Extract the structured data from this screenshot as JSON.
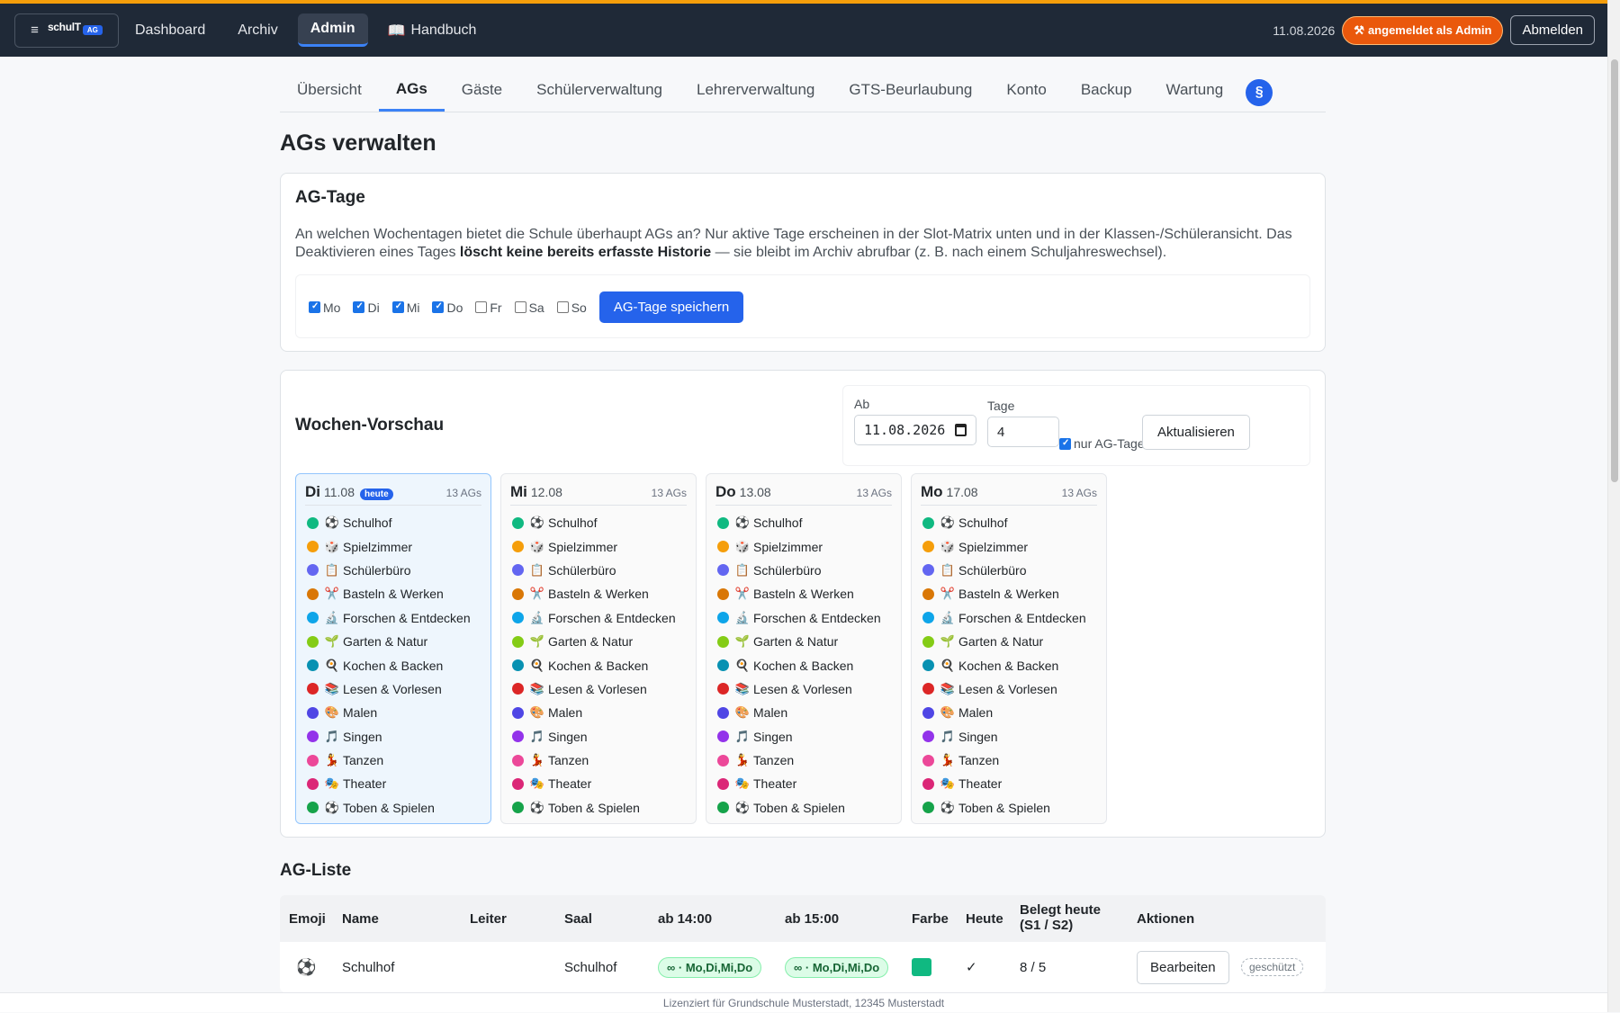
{
  "navbar": {
    "brand_logo": "schulT",
    "brand_tag": "AG",
    "links": [
      {
        "label": "Dashboard"
      },
      {
        "label": "Archiv"
      },
      {
        "label": "Admin"
      },
      {
        "label": "Handbuch",
        "icon": "📖"
      }
    ],
    "date": "11.08.2026",
    "admin_badge": "angemeldet als Admin",
    "logout": "Abmelden"
  },
  "tabs": [
    "Übersicht",
    "AGs",
    "Gäste",
    "Schülerverwaltung",
    "Lehrerverwaltung",
    "GTS-Beurlaubung",
    "Konto",
    "Backup",
    "Wartung"
  ],
  "tab_icon": "§",
  "page_title": "AGs verwalten",
  "ag_days": {
    "title": "AG-Tage",
    "desc_1": "An welchen Wochentagen bietet die Schule überhaupt AGs an? Nur aktive Tage erscheinen in der Slot-Matrix unten und in der Klassen-/Schüleransicht. Das Deaktivieren eines Tages ",
    "desc_bold": "löscht keine bereits erfasste Historie",
    "desc_2": " — sie bleibt im Archiv abrufbar (z. B. nach einem Schuljahreswechsel).",
    "days": [
      {
        "label": "Mo",
        "checked": true
      },
      {
        "label": "Di",
        "checked": true
      },
      {
        "label": "Mi",
        "checked": true
      },
      {
        "label": "Do",
        "checked": true
      },
      {
        "label": "Fr",
        "checked": false
      },
      {
        "label": "Sa",
        "checked": false
      },
      {
        "label": "So",
        "checked": false
      }
    ],
    "save": "AG-Tage speichern"
  },
  "week": {
    "title": "Wochen-Vorschau",
    "from_label": "Ab",
    "from_value": "11.08.2026",
    "days_label": "Tage",
    "days_value": "4",
    "only_ag_days": "nur AG-Tage",
    "refresh": "Aktualisieren",
    "columns": [
      {
        "day": "Di",
        "date": "11.08",
        "badge": "heute",
        "count": "13 AGs"
      },
      {
        "day": "Mi",
        "date": "12.08",
        "count": "13 AGs"
      },
      {
        "day": "Do",
        "date": "13.08",
        "count": "13 AGs"
      },
      {
        "day": "Mo",
        "date": "17.08",
        "count": "13 AGs"
      }
    ],
    "items": [
      {
        "emoji": "⚽",
        "name": "Schulhof",
        "color": "#10b981"
      },
      {
        "emoji": "🎲",
        "name": "Spielzimmer",
        "color": "#f59e0b"
      },
      {
        "emoji": "📋",
        "name": "Schülerbüro",
        "color": "#6366f1"
      },
      {
        "emoji": "✂️",
        "name": "Basteln & Werken",
        "color": "#d97706"
      },
      {
        "emoji": "🔬",
        "name": "Forschen & Entdecken",
        "color": "#0ea5e9"
      },
      {
        "emoji": "🌱",
        "name": "Garten & Natur",
        "color": "#84cc16"
      },
      {
        "emoji": "🍳",
        "name": "Kochen & Backen",
        "color": "#0891b2"
      },
      {
        "emoji": "📚",
        "name": "Lesen & Vorlesen",
        "color": "#dc2626"
      },
      {
        "emoji": "🎨",
        "name": "Malen",
        "color": "#4f46e5"
      },
      {
        "emoji": "🎵",
        "name": "Singen",
        "color": "#9333ea"
      },
      {
        "emoji": "💃",
        "name": "Tanzen",
        "color": "#ec4899"
      },
      {
        "emoji": "🎭",
        "name": "Theater",
        "color": "#db2777"
      },
      {
        "emoji": "⚽",
        "name": "Toben & Spielen",
        "color": "#16a34a"
      }
    ]
  },
  "ag_list": {
    "title": "AG-Liste",
    "headers": [
      "Emoji",
      "Name",
      "Leiter",
      "Saal",
      "ab 14:00",
      "ab 15:00",
      "Farbe",
      "Heute",
      "Belegt heute",
      "(S1 / S2)",
      "Aktionen"
    ],
    "rows": [
      {
        "emoji": "⚽",
        "name": "Schulhof",
        "leiter": "",
        "saal": "Schulhof",
        "slot1": "∞ · Mo,Di,Mi,Do",
        "slot2": "∞ · Mo,Di,Mi,Do",
        "color": "#10b981",
        "heute": "✓",
        "belegt": "8 / 5",
        "edit": "Bearbeiten",
        "protected": "geschützt"
      }
    ]
  },
  "footer": "Lizenziert für Grundschule Musterstadt, 12345 Musterstadt"
}
